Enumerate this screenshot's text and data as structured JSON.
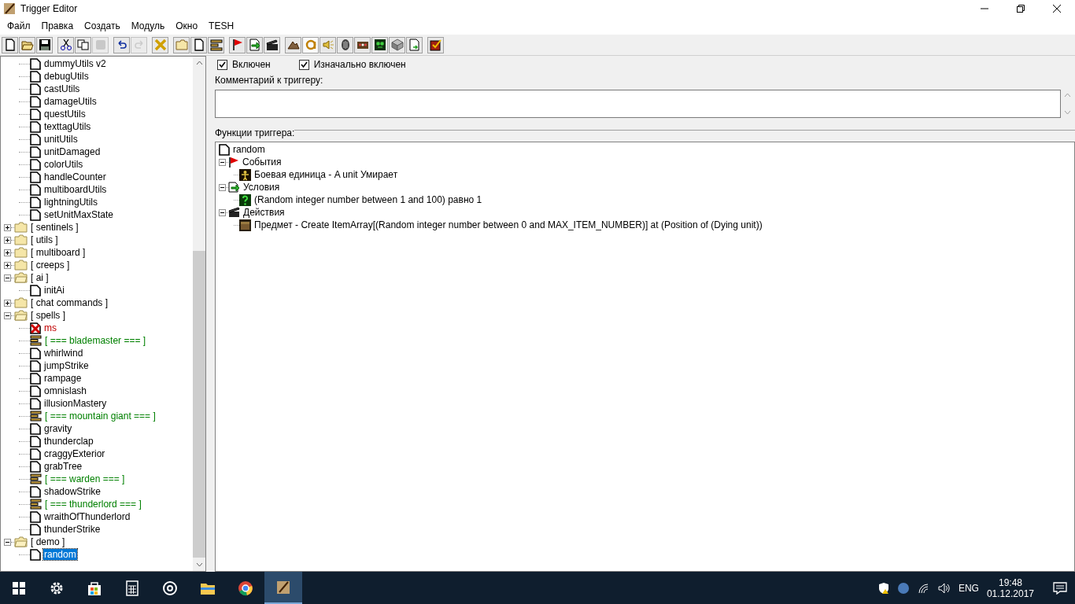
{
  "window": {
    "title": "Trigger Editor"
  },
  "menu": [
    "Файл",
    "Правка",
    "Создать",
    "Модуль",
    "Окно",
    "TESH"
  ],
  "toolbar": [
    [
      {
        "kind": "new",
        "disabled": false
      },
      {
        "kind": "open",
        "disabled": false
      },
      {
        "kind": "save",
        "disabled": false
      }
    ],
    [
      {
        "kind": "cut",
        "disabled": false
      },
      {
        "kind": "copy",
        "disabled": false
      },
      {
        "kind": "paste",
        "disabled": true
      }
    ],
    [
      {
        "kind": "undo",
        "disabled": false
      },
      {
        "kind": "redo",
        "disabled": true
      }
    ],
    [
      {
        "kind": "cross",
        "disabled": false
      }
    ],
    [
      {
        "kind": "folder",
        "disabled": false
      },
      {
        "kind": "page",
        "disabled": false
      },
      {
        "kind": "comment",
        "disabled": false
      }
    ],
    [
      {
        "kind": "flag",
        "disabled": false
      },
      {
        "kind": "arrowdoc",
        "disabled": false
      },
      {
        "kind": "clapper",
        "disabled": false
      }
    ],
    [
      {
        "kind": "terrain",
        "disabled": false,
        "pressed": false
      },
      {
        "kind": "letter",
        "disabled": false,
        "pressed": true
      },
      {
        "kind": "sound",
        "disabled": false,
        "pressed": false
      },
      {
        "kind": "unit",
        "disabled": false,
        "pressed": false
      },
      {
        "kind": "panel",
        "disabled": false,
        "pressed": false
      },
      {
        "kind": "monster",
        "disabled": false,
        "pressed": false
      },
      {
        "kind": "cube",
        "disabled": false,
        "pressed": false
      },
      {
        "kind": "import",
        "disabled": false,
        "pressed": false
      }
    ],
    [
      {
        "kind": "check",
        "disabled": false
      }
    ]
  ],
  "tree": {
    "top_items": [
      {
        "label": "dummyUtils v2",
        "kind": "trigger",
        "selected": false
      },
      {
        "label": "debugUtils",
        "kind": "trigger",
        "selected": false
      },
      {
        "label": "castUtils",
        "kind": "trigger",
        "selected": false
      },
      {
        "label": "damageUtils",
        "kind": "trigger",
        "selected": false
      },
      {
        "label": "questUtils",
        "kind": "trigger",
        "selected": false
      },
      {
        "label": "texttagUtils",
        "kind": "trigger",
        "selected": false
      },
      {
        "label": "unitUtils",
        "kind": "trigger",
        "selected": false
      },
      {
        "label": "unitDamaged",
        "kind": "trigger",
        "selected": false
      },
      {
        "label": "colorUtils",
        "kind": "trigger",
        "selected": false
      },
      {
        "label": "handleCounter",
        "kind": "trigger",
        "selected": false
      },
      {
        "label": "multiboardUtils",
        "kind": "trigger",
        "selected": false
      },
      {
        "label": "lightningUtils",
        "kind": "trigger",
        "selected": false
      },
      {
        "label": "setUnitMaxState",
        "kind": "trigger",
        "selected": false
      }
    ],
    "items": [
      {
        "label": "[ sentinels ]",
        "kind": "folder",
        "expanded": false,
        "selected": false
      },
      {
        "label": "[ utils ]",
        "kind": "folder",
        "expanded": false,
        "selected": false
      },
      {
        "label": "[ multiboard ]",
        "kind": "folder",
        "expanded": false,
        "selected": false
      },
      {
        "label": "[ creeps ]",
        "kind": "folder",
        "expanded": false,
        "selected": false
      },
      {
        "label": "[ ai ]",
        "kind": "folder",
        "expanded": true,
        "selected": false,
        "children": [
          {
            "label": "initAi",
            "kind": "trigger",
            "selected": false
          }
        ]
      },
      {
        "label": "[ chat commands ]",
        "kind": "folder",
        "expanded": false,
        "selected": false
      },
      {
        "label": "[ spells ]",
        "kind": "folder",
        "expanded": true,
        "selected": false,
        "children": [
          {
            "label": "ms",
            "kind": "disabled",
            "selected": false
          },
          {
            "label": "[ === blademaster === ]",
            "kind": "comment",
            "selected": false
          },
          {
            "label": "whirlwind",
            "kind": "trigger",
            "selected": false
          },
          {
            "label": "jumpStrike",
            "kind": "trigger",
            "selected": false
          },
          {
            "label": "rampage",
            "kind": "trigger",
            "selected": false
          },
          {
            "label": "omnislash",
            "kind": "trigger",
            "selected": false
          },
          {
            "label": "illusionMastery",
            "kind": "trigger",
            "selected": false
          },
          {
            "label": "[ === mountain giant === ]",
            "kind": "comment",
            "selected": false
          },
          {
            "label": "gravity",
            "kind": "trigger",
            "selected": false
          },
          {
            "label": "thunderclap",
            "kind": "trigger",
            "selected": false
          },
          {
            "label": "craggyExterior",
            "kind": "trigger",
            "selected": false
          },
          {
            "label": "grabTree",
            "kind": "trigger",
            "selected": false
          },
          {
            "label": "[ === warden === ]",
            "kind": "comment",
            "selected": false
          },
          {
            "label": "shadowStrike",
            "kind": "trigger",
            "selected": false
          },
          {
            "label": "[ === thunderlord === ]",
            "kind": "comment",
            "selected": false
          },
          {
            "label": "wraithOfThunderlord",
            "kind": "trigger",
            "selected": false
          },
          {
            "label": "thunderStrike",
            "kind": "trigger",
            "selected": false
          }
        ]
      },
      {
        "label": "[ demo ]",
        "kind": "folder",
        "expanded": true,
        "selected": false,
        "children": [
          {
            "label": "random",
            "kind": "trigger",
            "selected": true
          }
        ]
      }
    ]
  },
  "trigger": {
    "enabled": {
      "label": "Включен",
      "checked": true
    },
    "initially_on": {
      "label": "Изначально включен",
      "checked": true
    },
    "comment_label": "Комментарий к триггеру:",
    "functions_label": "Функции триггера:",
    "functions": {
      "label": "random",
      "sections": [
        {
          "label": "События",
          "kind": "events",
          "expanded": true,
          "children": [
            {
              "label": "Боевая единица - A unit Умирает",
              "kind": "unit"
            }
          ]
        },
        {
          "label": "Условия",
          "kind": "conditions",
          "expanded": true,
          "children": [
            {
              "label": "(Random integer number between 1 and 100) равно 1",
              "kind": "question"
            }
          ]
        },
        {
          "label": "Действия",
          "kind": "actions",
          "expanded": true,
          "children": [
            {
              "label": "Предмет - Create ItemArray[(Random integer number between 0 and MAX_ITEM_NUMBER)] at (Position of (Dying unit))",
              "kind": "item"
            }
          ]
        }
      ]
    }
  },
  "taskbar": {
    "apps": [
      {
        "kind": "settings",
        "active": false
      },
      {
        "kind": "store",
        "active": false
      },
      {
        "kind": "calculator",
        "active": false
      },
      {
        "kind": "groove",
        "active": false
      },
      {
        "kind": "explorer",
        "active": false
      },
      {
        "kind": "browser",
        "active": false
      },
      {
        "kind": "editor",
        "active": true
      }
    ],
    "language": "ENG",
    "time": "19:48",
    "date": "01.12.2017"
  }
}
